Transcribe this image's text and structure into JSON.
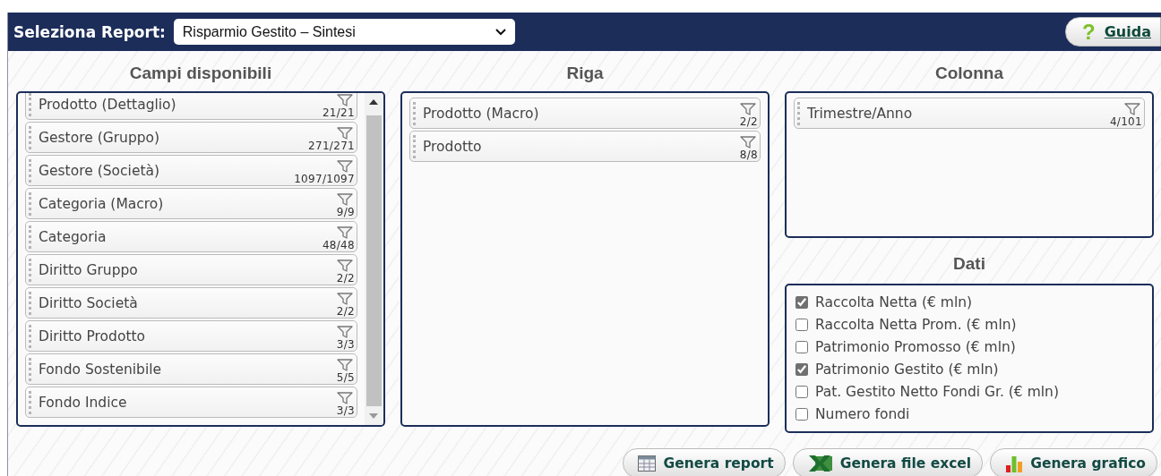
{
  "header": {
    "label": "Seleziona Report:",
    "report_select": {
      "value": "Risparmio Gestito – Sintesi"
    },
    "help_button": {
      "icon": "?",
      "label": "Guida"
    }
  },
  "fields_panel": {
    "title": "Campi disponibili",
    "items": [
      {
        "label": "Prodotto (Dettaglio)",
        "count": "21/21"
      },
      {
        "label": "Gestore (Gruppo)",
        "count": "271/271"
      },
      {
        "label": "Gestore (Società)",
        "count": "1097/1097"
      },
      {
        "label": "Categoria (Macro)",
        "count": "9/9"
      },
      {
        "label": "Categoria",
        "count": "48/48"
      },
      {
        "label": "Diritto Gruppo",
        "count": "2/2"
      },
      {
        "label": "Diritto Società",
        "count": "2/2"
      },
      {
        "label": "Diritto Prodotto",
        "count": "3/3"
      },
      {
        "label": "Fondo Sostenibile",
        "count": "5/5"
      },
      {
        "label": "Fondo Indice",
        "count": "3/3"
      }
    ]
  },
  "row_panel": {
    "title": "Riga",
    "items": [
      {
        "label": "Prodotto (Macro)",
        "count": "2/2"
      },
      {
        "label": "Prodotto",
        "count": "8/8"
      }
    ]
  },
  "column_panel": {
    "title": "Colonna",
    "items": [
      {
        "label": "Trimestre/Anno",
        "count": "4/101"
      }
    ]
  },
  "data_panel": {
    "title": "Dati",
    "options": [
      {
        "label": "Raccolta Netta (€ mln)",
        "checked": true
      },
      {
        "label": "Raccolta Netta Prom. (€ mln)",
        "checked": false
      },
      {
        "label": "Patrimonio Promosso (€ mln)",
        "checked": false
      },
      {
        "label": "Patrimonio Gestito (€ mln)",
        "checked": true
      },
      {
        "label": "Pat. Gestito Netto Fondi Gr. (€ mln)",
        "checked": false
      },
      {
        "label": "Numero fondi",
        "checked": false
      }
    ]
  },
  "buttons": [
    {
      "kind": "table",
      "label": "Genera report"
    },
    {
      "kind": "excel",
      "label": "Genera file excel"
    },
    {
      "kind": "chart",
      "label": "Genera grafico"
    }
  ]
}
